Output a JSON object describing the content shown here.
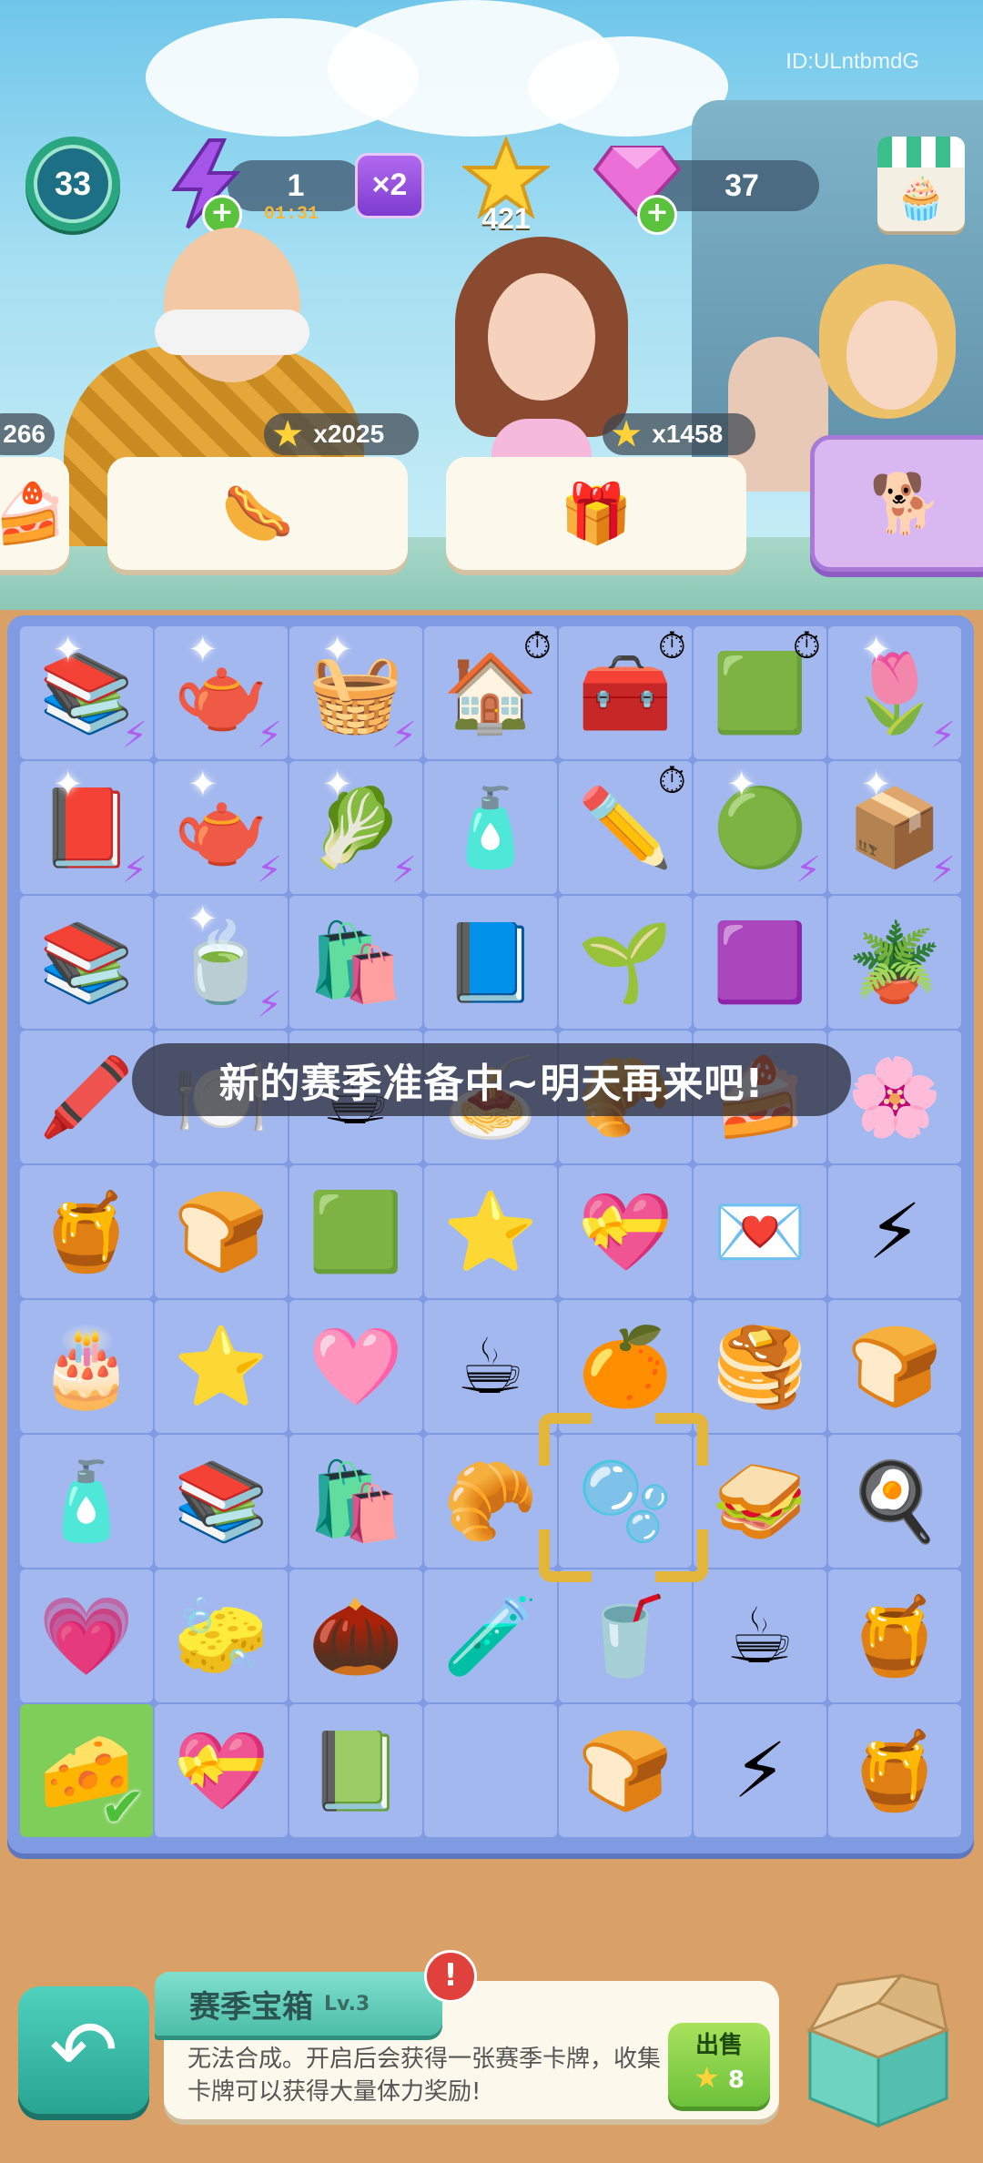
{
  "player_id": "ID:ULntbmdG",
  "topbar": {
    "level": "33",
    "energy": "1",
    "energy_timer": "01:31",
    "multiplier": "×2",
    "stars": "421",
    "gems": "37",
    "plus": "+"
  },
  "orders": [
    {
      "stars": "266",
      "item": "cake-icon"
    },
    {
      "stars": "x2025",
      "item": "hotdog-icon",
      "item_glyph": "🌭"
    },
    {
      "stars": "x1458",
      "item": "gift-box-icon",
      "item_glyph": "🎁"
    },
    {
      "item": "shiba-dog-skateboard-icon",
      "item_glyph": "🐕"
    }
  ],
  "board": {
    "rows": [
      [
        {
          "name": "bookshelf-item",
          "glyph": "📚",
          "spark": true,
          "bolt": true
        },
        {
          "name": "tea-cart-item",
          "glyph": "🫖",
          "spark": true,
          "bolt": true
        },
        {
          "name": "vegetable-basket-item",
          "glyph": "🧺",
          "spark": true,
          "bolt": true
        },
        {
          "name": "honey-house-item",
          "glyph": "🏠",
          "clock": true
        },
        {
          "name": "pencil-case-item",
          "glyph": "🧰",
          "clock": true
        },
        {
          "name": "green-oven-item",
          "glyph": "🟩",
          "clock": true
        },
        {
          "name": "flower-pot-item",
          "glyph": "🌷",
          "spark": true,
          "bolt": true
        }
      ],
      [
        {
          "name": "book-cart-item",
          "glyph": "📕",
          "spark": true,
          "bolt": true
        },
        {
          "name": "tea-set-item",
          "glyph": "🫖",
          "spark": true,
          "bolt": true
        },
        {
          "name": "veg-crate-item",
          "glyph": "🥬",
          "spark": true,
          "bolt": true
        },
        {
          "name": "perfume-bottle-item",
          "glyph": "🧴"
        },
        {
          "name": "pencil-pouch-item",
          "glyph": "✏️",
          "clock": true
        },
        {
          "name": "green-stove-item",
          "glyph": "🟢",
          "spark": true,
          "bolt": true
        },
        {
          "name": "cardboard-box-item",
          "glyph": "📦",
          "spark": true,
          "bolt": true
        }
      ],
      [
        {
          "name": "book-crate-item",
          "glyph": "📚"
        },
        {
          "name": "tea-tray-item",
          "glyph": "🍵",
          "spark": true,
          "bolt": true
        },
        {
          "name": "blue-bag-item",
          "glyph": "🛍️"
        },
        {
          "name": "book-stack-item",
          "glyph": "📘"
        },
        {
          "name": "sprout-item",
          "glyph": "🌱"
        },
        {
          "name": "purple-box-item",
          "glyph": "🟪"
        },
        {
          "name": "potted-plant-item",
          "glyph": "🪴"
        }
      ],
      [
        {
          "name": "crayons-item",
          "glyph": "🖍️"
        },
        {
          "name": "hidden-item-1",
          "glyph": "🍽️"
        },
        {
          "name": "hidden-item-2",
          "glyph": "☕"
        },
        {
          "name": "hidden-item-3",
          "glyph": "🍝"
        },
        {
          "name": "hidden-item-4",
          "glyph": "🥐"
        },
        {
          "name": "hidden-item-5",
          "glyph": "🍰"
        },
        {
          "name": "flower-mat-item",
          "glyph": "🌸"
        }
      ],
      [
        {
          "name": "honeycomb-item",
          "glyph": "🍯"
        },
        {
          "name": "green-toaster-item",
          "glyph": "🍞"
        },
        {
          "name": "green-oven-small-item",
          "glyph": "🟩"
        },
        {
          "name": "stars-item",
          "glyph": "⭐"
        },
        {
          "name": "heart-box-item",
          "glyph": "💝"
        },
        {
          "name": "love-letter-item",
          "glyph": "💌"
        },
        {
          "name": "green-bolts-item",
          "glyph": "⚡"
        }
      ],
      [
        {
          "name": "strawberry-cake-item",
          "glyph": "🎂"
        },
        {
          "name": "star-item",
          "glyph": "⭐"
        },
        {
          "name": "pink-napkins-item",
          "glyph": "🩷"
        },
        {
          "name": "coffee-cup-item",
          "glyph": "☕"
        },
        {
          "name": "orange-item",
          "glyph": "🍊"
        },
        {
          "name": "pancakes-item",
          "glyph": "🥞"
        },
        {
          "name": "bread-loaf-pan-item",
          "glyph": "🍞"
        }
      ],
      [
        {
          "name": "perfume-small-item",
          "glyph": "🧴"
        },
        {
          "name": "book-box-item",
          "glyph": "📚"
        },
        {
          "name": "blue-bag-small-item",
          "glyph": "🛍️"
        },
        {
          "name": "croissant-flowers-item",
          "glyph": "🥐"
        },
        {
          "name": "season-chest-item",
          "glyph": "🫧"
        },
        {
          "name": "sandwich-item",
          "glyph": "🥪"
        },
        {
          "name": "egg-toast-item",
          "glyph": "🍳"
        }
      ],
      [
        {
          "name": "heart-gift-item",
          "glyph": "💗"
        },
        {
          "name": "eraser-item",
          "glyph": "🧽"
        },
        {
          "name": "chestnut-item",
          "glyph": "🌰"
        },
        {
          "name": "perfume-round-item",
          "glyph": "🧪"
        },
        {
          "name": "iced-drink-item",
          "glyph": "🥤"
        },
        {
          "name": "coffee-to-go-item",
          "glyph": "☕"
        },
        {
          "name": "honey-jar-item",
          "glyph": "🍯"
        }
      ],
      [
        {
          "name": "honey-cake-item",
          "glyph": "🧀",
          "selected": true
        },
        {
          "name": "heart-box-flowers-item",
          "glyph": "💝"
        },
        {
          "name": "picture-book-item",
          "glyph": "📗"
        },
        {
          "name": "empty-cell",
          "glyph": ""
        },
        {
          "name": "bread-tray-item",
          "glyph": "🍞"
        },
        {
          "name": "green-bolts-small-item",
          "glyph": "⚡"
        },
        {
          "name": "honey-jar-small-item",
          "glyph": "🍯"
        }
      ]
    ]
  },
  "toast": "新的赛季准备中~明天再来吧!",
  "info_panel": {
    "title": "赛季宝箱",
    "level": "Lv.3",
    "alert": "!",
    "description": "无法合成。开启后会获得一张赛季卡牌，收集卡牌可以获得大量体力奖励!",
    "sell_label": "出售",
    "sell_price": "8"
  },
  "colors": {
    "board": "#7f9be2",
    "cell": "#a3b8ef",
    "selected_cell": "#7fce5a",
    "focus_frame": "#e3b53a",
    "back_button": "#27a592"
  }
}
